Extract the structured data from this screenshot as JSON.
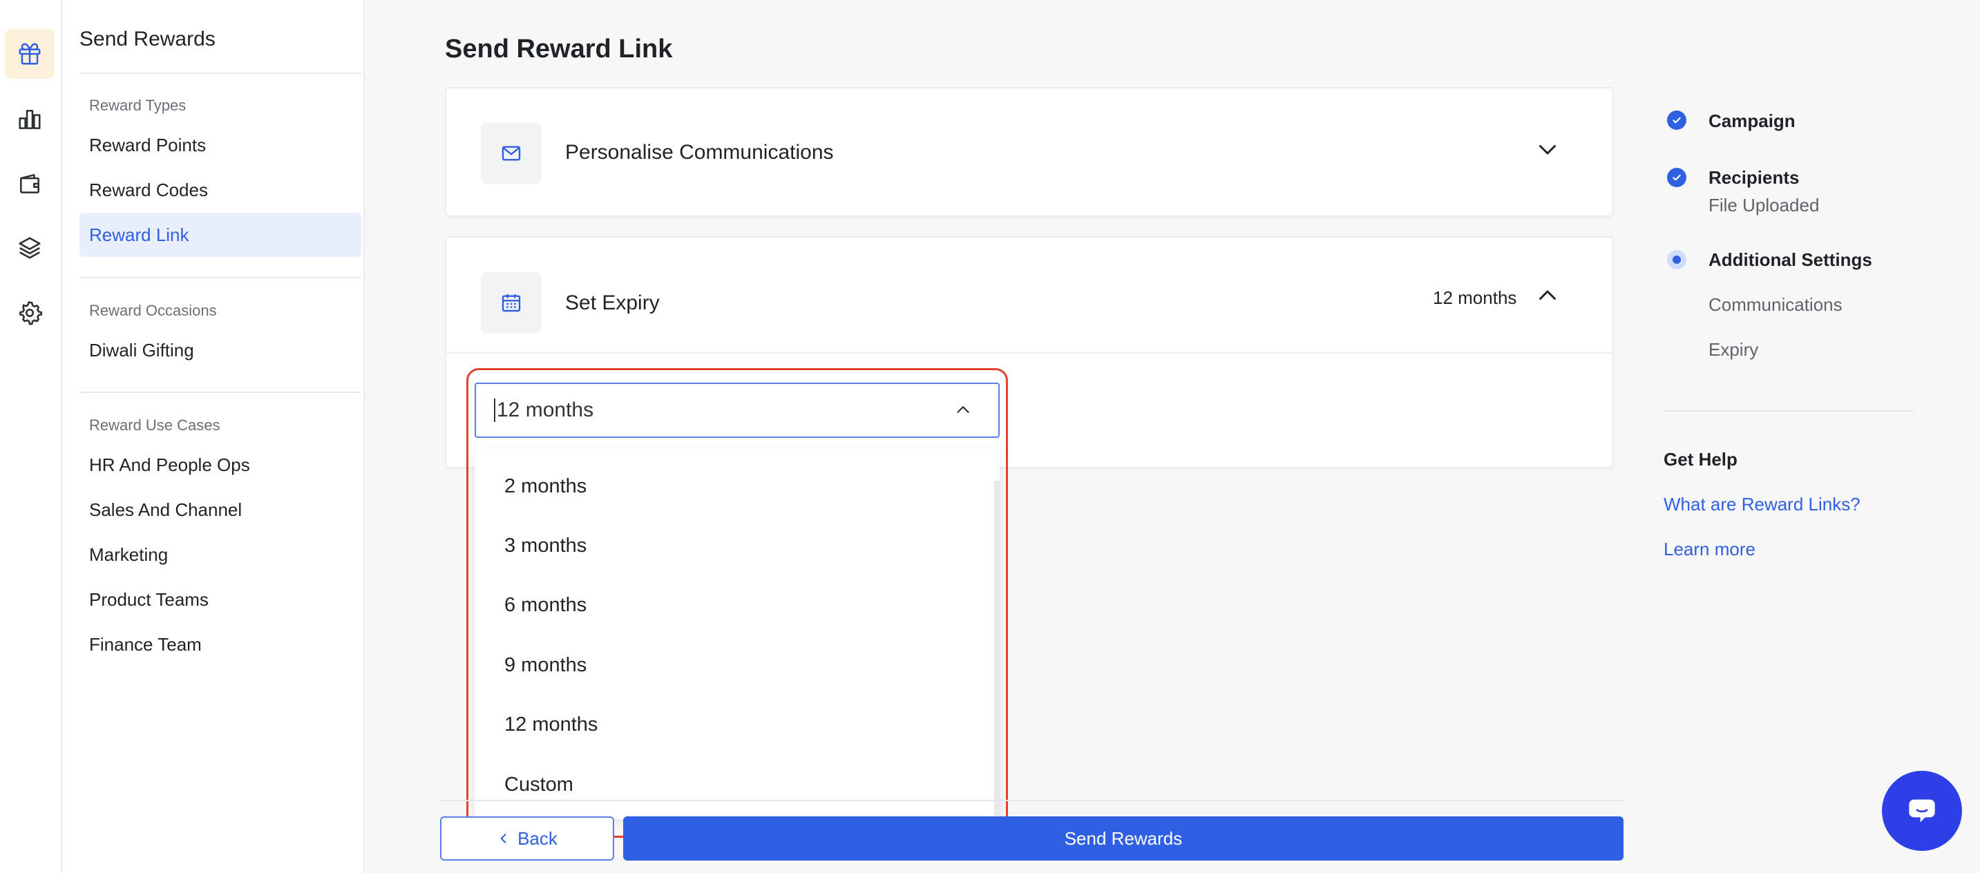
{
  "rail": {
    "icons": [
      "gift-icon",
      "bar-chart-icon",
      "wallet-icon",
      "layers-icon",
      "gear-icon"
    ],
    "active_color": "#fdf1dc",
    "icon_color": "#2f5fe3"
  },
  "sidebar": {
    "title": "Send Rewards",
    "sections": [
      {
        "heading": "Reward Types",
        "items": [
          "Reward Points",
          "Reward Codes",
          "Reward Link"
        ]
      },
      {
        "heading": "Reward Occasions",
        "items": [
          "Diwali Gifting"
        ]
      },
      {
        "heading": "Reward Use Cases",
        "items": [
          "HR And People Ops",
          "Sales And Channel",
          "Marketing",
          "Product Teams",
          "Finance Team"
        ]
      }
    ],
    "active_item": "Reward Link"
  },
  "main": {
    "title": "Send Reward Link",
    "cards": [
      {
        "title": "Personalise Communications",
        "icon": "mail-icon",
        "expanded": false
      },
      {
        "title": "Set Expiry",
        "icon": "calendar-icon",
        "value": "12 months",
        "expanded": true
      }
    ],
    "expiry_select": {
      "value": "12 months",
      "options": [
        "2 months",
        "3 months",
        "6 months",
        "9 months",
        "12 months",
        "Custom"
      ]
    },
    "footer": {
      "back_label": "Back",
      "send_label": "Send Rewards"
    }
  },
  "steps": [
    {
      "label": "Campaign",
      "status": "done"
    },
    {
      "label": "Recipients",
      "status": "done",
      "sub": "File Uploaded"
    },
    {
      "label": "Additional Settings",
      "status": "current",
      "subs": [
        "Communications",
        "Expiry"
      ]
    }
  ],
  "help": {
    "title": "Get Help",
    "links": [
      "What are Reward Links?",
      "Learn more"
    ]
  },
  "colors": {
    "primary": "#2f5fe3",
    "highlight": "#e4412e",
    "chat": "#2f3fe8"
  }
}
